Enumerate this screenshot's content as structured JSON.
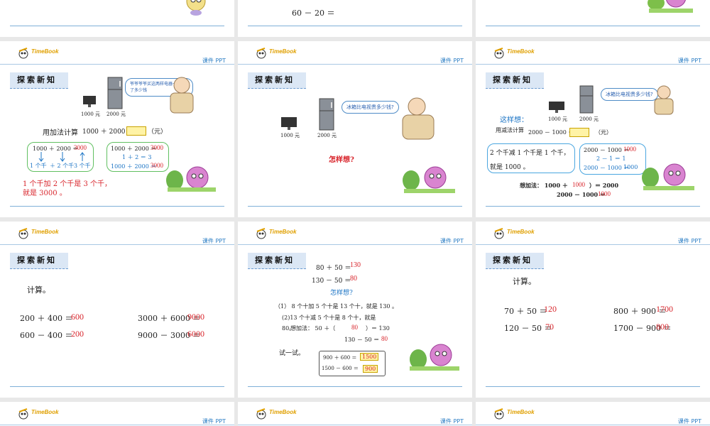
{
  "common": {
    "logo_text": "TimeBook",
    "ppt_label": "课件 PPT",
    "section_title": "探索新知"
  },
  "row1": {
    "equation": "60 － 20 ＝"
  },
  "slide_a": {
    "price_tv": "1000 元",
    "price_fridge": "2000 元",
    "bubble": "爷爷爷爷买这两样电器一共花了多少钱",
    "add_prompt": "用加法计算",
    "add_eq": "1000 ＋ 2000 ＝",
    "unit": "（元）",
    "left_eq": "1000 ＋ 2000 ＝",
    "left_ans": "3000",
    "left_steps": [
      "1 个千",
      "＋ 2 个千",
      "3 个千"
    ],
    "right_eq": "1000 ＋ 2000 ＝",
    "right_ans": "3000",
    "right_mid": "1 ＋ 2 ＝ 3",
    "right_bottom": "1000 ＋ 2000 ＝",
    "right_bottom_ans": "3000",
    "explain_line1": "1 个千加 2 个千是 3 个千，",
    "explain_line2": "就是 3000 。"
  },
  "slide_b": {
    "price_tv": "1000 元",
    "price_fridge": "2000 元",
    "bubble": "冰箱比电视贵多少钱?",
    "question": "怎样想?"
  },
  "slide_c": {
    "price_tv": "1000 元",
    "price_fridge": "2000 元",
    "bubble": "冰箱比电视贵多少钱?",
    "think": "这样想：",
    "sub_prompt": "用减法计算",
    "sub_eq": "2000 － 1000 ＝",
    "unit": "（元）",
    "left_text1": "2 个千减 1 个千是 1 个千，",
    "left_text2": "就是 1000 。",
    "box_eq1": "2000 － 1000 ＝",
    "box_ans1": "1000",
    "box_eq2": "2 － 1 ＝ 1",
    "box_eq3": "2000 － 1000 ＝",
    "box_ans3": "1000",
    "add_think": "想加法：  1000 ＋",
    "add_think_ans": "1000",
    "add_think_rest": "）＝ 2000",
    "bottom_eq": "2000 － 1000 ＝",
    "bottom_ans": "1000"
  },
  "slide_d": {
    "calc": "计算。",
    "eq1": "200 ＋ 400 ＝",
    "ans1": "600",
    "eq2": "3000 ＋ 6000 ＝",
    "ans2": "9000",
    "eq3": "600 － 400 ＝",
    "ans3": "200",
    "eq4": "9000 － 3000 ＝",
    "ans4": "6000"
  },
  "slide_e": {
    "eq1": "80 ＋ 50 ＝",
    "ans1": "130",
    "eq2": "130 － 50 ＝",
    "ans2": "80",
    "question": "怎样想?",
    "line1": "（1） 8 个十加 5 个十是 13 个十，就是 130 。",
    "line2": "(2)13 个十减 5 个十是 8 个十，就是",
    "line3a": "80。",
    "line3b": "想加法：  50 ＋（",
    "line3_ans": "80",
    "line3c": "）＝ 130",
    "line4": "130 － 50 ＝",
    "line4_ans": "80",
    "try": "试一试。",
    "try_eq1": "900 ＋ 600 ＝",
    "try_ans1": "1500",
    "try_eq2": "1500 － 600 ＝",
    "try_ans2": "900"
  },
  "slide_f": {
    "calc": "计算。",
    "eq1": "70 ＋ 50 ＝",
    "ans1": "120",
    "eq2": "800 ＋ 900 ＝",
    "ans2": "1700",
    "eq3": "120 － 50 ＝",
    "ans3": "70",
    "eq4": "1700 － 900 ＝",
    "ans4": "800"
  },
  "colors": {
    "accent_red": "#d8232a",
    "accent_blue": "#1b74c5",
    "logo_gold": "#e0a000",
    "rule_blue": "#7fb0d8"
  }
}
